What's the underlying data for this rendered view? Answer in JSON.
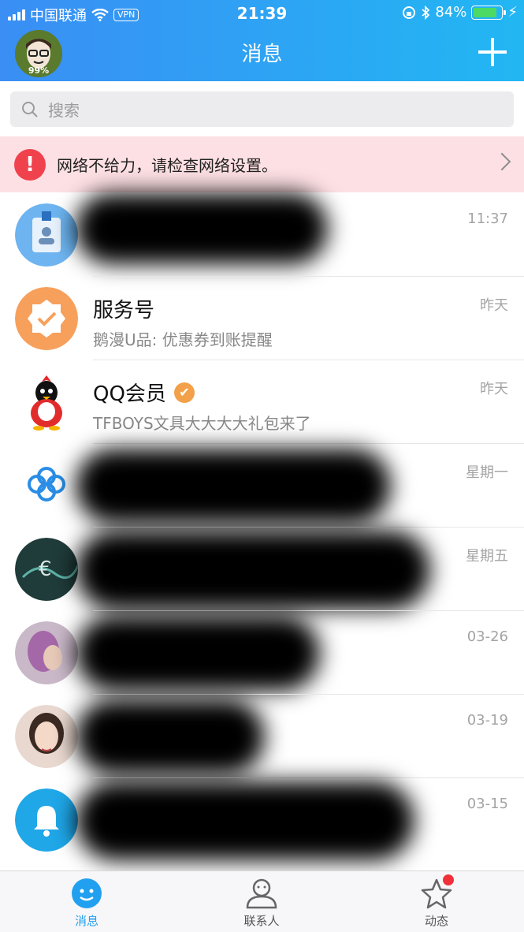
{
  "status_bar": {
    "carrier": "中国联通",
    "vpn": "VPN",
    "time": "21:39",
    "battery": "84%",
    "battery_level": 0.84
  },
  "header": {
    "title": "消息",
    "avatar_badge": "99%"
  },
  "search": {
    "placeholder": "搜索"
  },
  "alert": {
    "text": "网络不给力，请检查网络设置。"
  },
  "conversations": [
    {
      "name": "",
      "preview": "",
      "time": "11:37",
      "icon": "id-badge-icon"
    },
    {
      "name": "服务号",
      "preview": "鹅漫U品: 优惠券到账提醒",
      "time": "昨天",
      "icon": "service-badge-icon"
    },
    {
      "name": "QQ会员",
      "preview": "TFBOYS文具大大大大礼包来了",
      "time": "昨天",
      "icon": "qq-penguin-icon"
    },
    {
      "name": "",
      "preview": "",
      "time": "星期一",
      "icon": "infinity-logo-icon"
    },
    {
      "name": "",
      "preview": "",
      "time": "星期五",
      "icon": "photo-avatar"
    },
    {
      "name": "",
      "preview": "",
      "time": "03-26",
      "icon": "photo-avatar"
    },
    {
      "name": "",
      "preview": "",
      "time": "03-19",
      "icon": "photo-avatar"
    },
    {
      "name": "",
      "preview": "",
      "time": "03-15",
      "icon": "bell-icon"
    }
  ],
  "tabs": [
    {
      "label": "消息",
      "active": true
    },
    {
      "label": "联系人",
      "active": false
    },
    {
      "label": "动态",
      "active": false
    }
  ],
  "colors": {
    "header_start": "#3a8ef4",
    "header_end": "#22b7f3",
    "alert_bg": "#fde0e4",
    "alert_icon": "#f0424d",
    "tab_active": "#22a0f0"
  }
}
